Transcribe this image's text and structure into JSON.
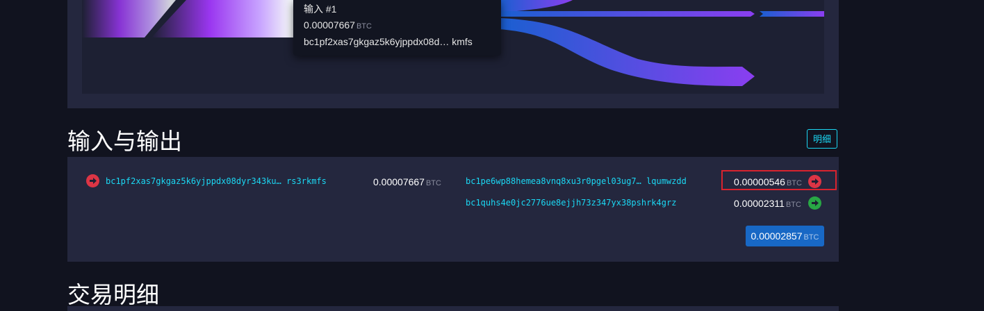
{
  "tooltip": {
    "title": "输入 #1",
    "amount": "0.00007667",
    "unit": "BTC",
    "address": "bc1pf2xas7gkgaz5k6yjppdx08d… kmfs"
  },
  "io_section": {
    "title": "输入与输出",
    "details_label": "明细"
  },
  "inputs": [
    {
      "address": "bc1pf2xas7gkgaz5k6yjppdx08dyr343ku… rs3rkmfs",
      "amount": "0.00007667",
      "unit": "BTC",
      "icon": "arrow-right-circle-icon",
      "status_color": "#dc3545"
    }
  ],
  "outputs": [
    {
      "address": "bc1pe6wp88hemea8vnq8xu3r0pgel03ug7… lqumwzdd",
      "amount": "0.00000546",
      "unit": "BTC",
      "icon": "arrow-right-circle-icon",
      "status_color": "#dc3545"
    },
    {
      "address": "bc1quhs4e0jc2776ue8ejjh73z347yx38pshrk4grz",
      "amount": "0.00002311",
      "unit": "BTC",
      "icon": "arrow-right-circle-icon",
      "status_color": "#28a745"
    }
  ],
  "total": {
    "amount": "0.00002857",
    "unit": "BTC"
  },
  "details_section": {
    "title": "交易明细"
  },
  "colors": {
    "accent": "#1bd8f4",
    "total_badge": "#1868c5",
    "spent": "#dc3545",
    "unspent": "#28a745",
    "highlight": "#d9232e"
  }
}
